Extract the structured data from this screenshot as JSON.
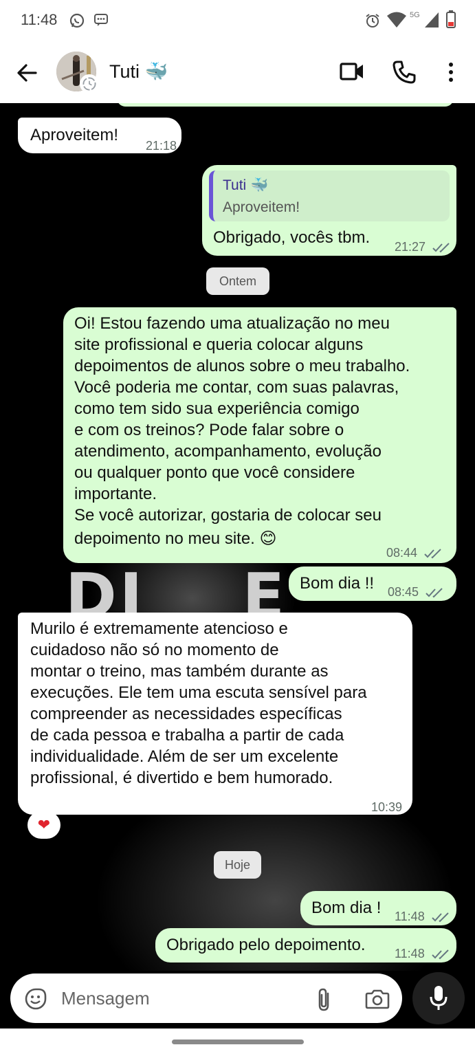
{
  "status_bar": {
    "time": "11:48",
    "network": "5G",
    "icons": [
      "whatsapp-icon",
      "message-icon",
      "alarm-icon",
      "wifi-icon",
      "signal-icon",
      "battery-icon"
    ]
  },
  "header": {
    "contact_name": "Tuti 🐳",
    "icons": [
      "back-arrow-icon",
      "video-call-icon",
      "phone-icon",
      "more-icon"
    ]
  },
  "messages": [
    {
      "id": "m1",
      "direction": "in",
      "text": "Aproveitem!",
      "time": "21:18"
    },
    {
      "id": "m2",
      "direction": "out",
      "quote_name": "Tuti 🐳",
      "quote_text": "Aproveitem!",
      "text": "Obrigado, vocês tbm.",
      "time": "21:27",
      "status": "read"
    },
    {
      "id": "d1",
      "type": "date",
      "text": "Ontem"
    },
    {
      "id": "m3",
      "direction": "out",
      "lines": [
        "Oi! Estou fazendo uma atualização no meu",
        "site profissional e queria colocar alguns",
        "depoimentos de alunos sobre o meu trabalho.",
        "Você poderia me contar, com suas palavras,",
        "como tem sido sua experiência comigo",
        "e com os treinos? Pode falar sobre o",
        "atendimento, acompanhamento, evolução",
        "ou qualquer ponto que você considere",
        "importante.",
        "Se você autorizar, gostaria de colocar seu",
        "depoimento no meu site. 😊"
      ],
      "time": "08:44",
      "status": "read"
    },
    {
      "id": "m4",
      "direction": "out",
      "text": "Bom dia !!",
      "time": "08:45",
      "status": "read"
    },
    {
      "id": "m5",
      "direction": "in",
      "lines": [
        "Murilo é extremamente atencioso e",
        "cuidadoso não só no momento de",
        "montar o treino, mas também durante as",
        "execuções. Ele tem uma escuta sensível para",
        "compreender as necessidades específicas",
        "de cada pessoa e trabalha a partir de cada",
        "individualidade. Além de ser um excelente",
        "profissional, é divertido e bem humorado."
      ],
      "time": "10:39",
      "reaction": "❤"
    },
    {
      "id": "d2",
      "type": "date",
      "text": "Hoje"
    },
    {
      "id": "m6",
      "direction": "out",
      "text": "Bom dia !",
      "time": "11:48",
      "status": "read"
    },
    {
      "id": "m7",
      "direction": "out",
      "text": "Obrigado pelo depoimento.",
      "time": "11:48",
      "status": "read"
    }
  ],
  "input": {
    "placeholder": "Mensagem",
    "icons": [
      "sticker-icon",
      "attach-icon",
      "camera-icon",
      "mic-icon"
    ]
  },
  "colors": {
    "outgoing_bubble": "#d9fdd3",
    "incoming_bubble": "#ffffff",
    "quote_bar": "#6a55d6",
    "read_ticks": "#667781"
  }
}
